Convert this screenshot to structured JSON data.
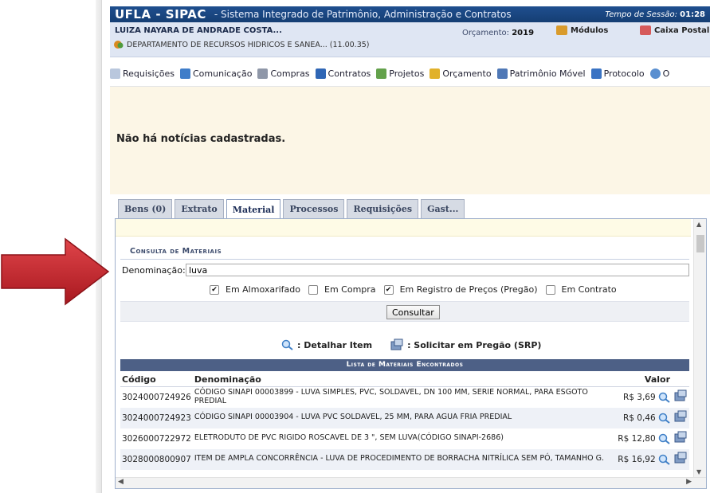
{
  "header": {
    "app_name": "UFLA - SIPAC",
    "app_subtitle": "- Sistema Integrado de Patrimônio, Administração e Contratos",
    "session_label": "Tempo de Sessão:",
    "session_value": "01:28"
  },
  "user": {
    "name": "LUIZA NAYARA DE ANDRADE COSTA...",
    "department": "DEPARTAMENTO DE RECURSOS HIDRICOS E SANEA... (11.00.35)",
    "budget_label": "Orçamento:",
    "budget_year": "2019",
    "modules_label": "Módulos",
    "mailbox_label": "Caixa Postal"
  },
  "menu": {
    "items": [
      {
        "label": "Requisições",
        "icon": "document-icon",
        "color": "#b9c7dd"
      },
      {
        "label": "Comunicação",
        "icon": "book-icon",
        "color": "#3f7dc9"
      },
      {
        "label": "Compras",
        "icon": "cart-icon",
        "color": "#8f97a8"
      },
      {
        "label": "Contratos",
        "icon": "contract-icon",
        "color": "#2f66b5"
      },
      {
        "label": "Projetos",
        "icon": "projects-icon",
        "color": "#63a14b"
      },
      {
        "label": "Orçamento",
        "icon": "budget-icon",
        "color": "#e1b12a"
      },
      {
        "label": "Patrimônio Móvel",
        "icon": "computer-icon",
        "color": "#4f78b6"
      },
      {
        "label": "Protocolo",
        "icon": "protocol-icon",
        "color": "#3a73c3"
      },
      {
        "label": "O",
        "icon": "search-icon",
        "color": "#5a8fd0"
      }
    ]
  },
  "news": {
    "message": "Não há notícias cadastradas."
  },
  "tabs": [
    {
      "label": "Bens (0)",
      "active": false
    },
    {
      "label": "Extrato",
      "active": false
    },
    {
      "label": "Material",
      "active": true
    },
    {
      "label": "Processos",
      "active": false
    },
    {
      "label": "Requisições",
      "active": false
    },
    {
      "label": "Gast...",
      "active": false
    }
  ],
  "consulta": {
    "title": "Consulta de Materiais",
    "denominacao_label": "Denominação:",
    "denominacao_value": "luva",
    "filters": [
      {
        "label": "Em Almoxarifado",
        "checked": true
      },
      {
        "label": "Em Compra",
        "checked": false
      },
      {
        "label": "Em Registro de Preços (Pregão)",
        "checked": true
      },
      {
        "label": "Em Contrato",
        "checked": false
      }
    ],
    "button_label": "Consultar"
  },
  "legend": {
    "detail_label": ": Detalhar Item",
    "request_label": ": Solicitar em Pregão (SRP)"
  },
  "results": {
    "title": "Lista de Materiais Encontrados",
    "columns": {
      "code": "Código",
      "name": "Denominação",
      "value": "Valor"
    },
    "rows": [
      {
        "code": "3024000724926",
        "name": "CÓDIGO SINAPI 00003899 - LUVA SIMPLES, PVC, SOLDAVEL, DN 100 MM, SERIE NORMAL, PARA ESGOTO PREDIAL",
        "value": "R$ 3,69"
      },
      {
        "code": "3024000724923",
        "name": "CÓDIGO SINAPI 00003904 - LUVA PVC SOLDAVEL, 25 MM, PARA AGUA FRIA PREDIAL",
        "value": "R$ 0,46"
      },
      {
        "code": "3026000722972",
        "name": "ELETRODUTO DE PVC RIGIDO ROSCAVEL DE 3 \", SEM LUVA(CÓDIGO SINAPI-2686)",
        "value": "R$ 12,80"
      },
      {
        "code": "3028000800907",
        "name": "ITEM DE AMPLA CONCORRÊNCIA - LUVA DE PROCEDIMENTO DE BORRACHA NITRÍLICA SEM PÓ, TAMANHO G.",
        "value": "R$ 16,92"
      }
    ]
  },
  "colors": {
    "topbar": "#1f4f8f",
    "news_bg": "#fcf6e6",
    "table_head": "#4d6086",
    "arrow": "#c0272d"
  }
}
